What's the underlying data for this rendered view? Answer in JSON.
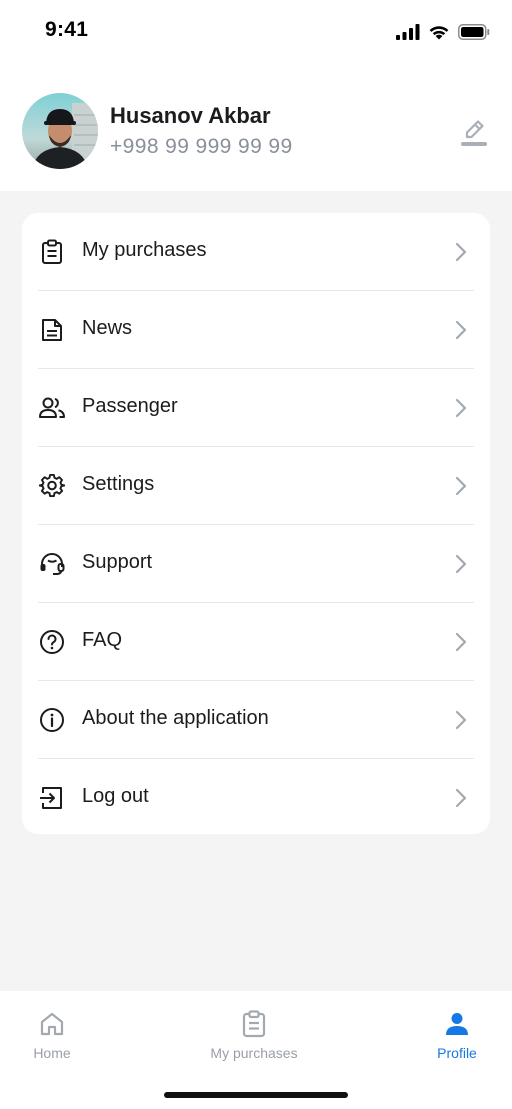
{
  "status_bar": {
    "time": "9:41"
  },
  "profile": {
    "name": "Husanov Akbar",
    "phone": "+998 99 999 99 99"
  },
  "menu": {
    "items": [
      {
        "label": "My purchases",
        "icon": "clipboard-icon"
      },
      {
        "label": "News",
        "icon": "document-icon"
      },
      {
        "label": "Passenger",
        "icon": "users-icon"
      },
      {
        "label": "Settings",
        "icon": "gear-icon"
      },
      {
        "label": "Support",
        "icon": "headset-icon"
      },
      {
        "label": "FAQ",
        "icon": "question-circle-icon"
      },
      {
        "label": "About the application",
        "icon": "info-circle-icon"
      },
      {
        "label": "Log out",
        "icon": "log-out-icon"
      }
    ]
  },
  "tab_bar": {
    "tabs": [
      {
        "label": "Home",
        "icon": "home-icon",
        "active": false
      },
      {
        "label": "My purchases",
        "icon": "clipboard-icon",
        "active": false
      },
      {
        "label": "Profile",
        "icon": "person-icon",
        "active": true
      }
    ]
  },
  "colors": {
    "accent": "#1678E5",
    "background": "#F4F4F4",
    "card": "#FFFFFF",
    "muted_text": "#8A9099",
    "chevron": "#A3A9B1"
  }
}
